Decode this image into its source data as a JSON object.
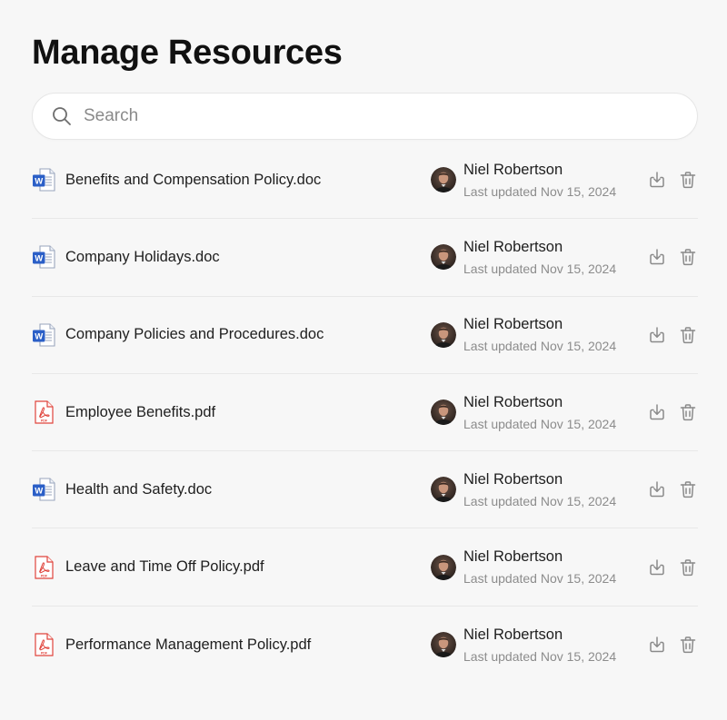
{
  "page": {
    "title": "Manage Resources"
  },
  "search": {
    "placeholder": "Search",
    "value": ""
  },
  "colors": {
    "word_blue": "#2b5fc7",
    "pdf_red": "#e0443c",
    "icon_gray": "#8a8a8a"
  },
  "files": [
    {
      "name": "Benefits and Compensation Policy.doc",
      "type": "doc",
      "icon": "word-doc-icon",
      "owner": "Niel Robertson",
      "updated": "Last updated Nov 15, 2024"
    },
    {
      "name": "Company Holidays.doc",
      "type": "doc",
      "icon": "word-doc-icon",
      "owner": "Niel Robertson",
      "updated": "Last updated Nov 15, 2024"
    },
    {
      "name": "Company Policies and Procedures.doc",
      "type": "doc",
      "icon": "word-doc-icon",
      "owner": "Niel Robertson",
      "updated": "Last updated Nov 15, 2024"
    },
    {
      "name": "Employee Benefits.pdf",
      "type": "pdf",
      "icon": "pdf-file-icon",
      "owner": "Niel Robertson",
      "updated": "Last updated Nov 15, 2024"
    },
    {
      "name": "Health and Safety.doc",
      "type": "doc",
      "icon": "word-doc-icon",
      "owner": "Niel Robertson",
      "updated": "Last updated Nov 15, 2024"
    },
    {
      "name": "Leave and Time Off Policy.pdf",
      "type": "pdf",
      "icon": "pdf-file-icon",
      "owner": "Niel Robertson",
      "updated": "Last updated Nov 15, 2024"
    },
    {
      "name": "Performance Management Policy.pdf",
      "type": "pdf",
      "icon": "pdf-file-icon",
      "owner": "Niel Robertson",
      "updated": "Last updated Nov 15, 2024"
    }
  ],
  "row_actions": {
    "download_icon": "download-icon",
    "delete_icon": "trash-icon"
  }
}
